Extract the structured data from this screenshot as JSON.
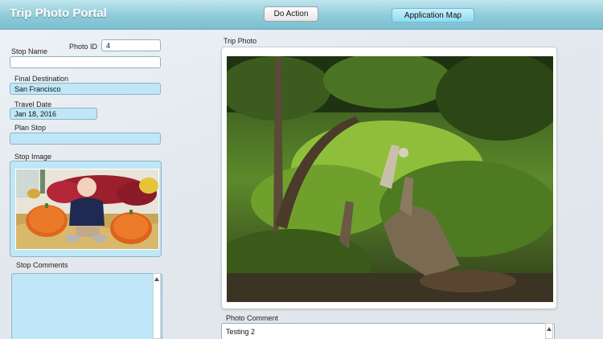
{
  "header": {
    "title": "Trip Photo Portal",
    "do_action_label": "Do Action",
    "application_map_label": "Application Map"
  },
  "form": {
    "photo_id": {
      "label": "Photo ID",
      "value": "4"
    },
    "stop_name": {
      "label": "Stop Name",
      "value": ""
    },
    "final_destination": {
      "label": "Final Destination",
      "value": "San Francisco"
    },
    "travel_date": {
      "label": "Travel Date",
      "value": "Jan 18, 2016"
    },
    "plan_stop": {
      "label": "Plan Stop",
      "value": ""
    },
    "stop_image": {
      "label": "Stop Image"
    },
    "stop_comments": {
      "label": "Stop Comments",
      "value": ""
    }
  },
  "trip_photo": {
    "label": "Trip Photo"
  },
  "photo_comment": {
    "label": "Photo Comment",
    "value": "Testing 2"
  },
  "icons": {
    "scroll_up": "scroll-up-arrow-icon"
  },
  "colors": {
    "header_accent": "#8fcbd9",
    "field_blue": "#bfe7f7",
    "map_button": "#a9e4f5"
  }
}
